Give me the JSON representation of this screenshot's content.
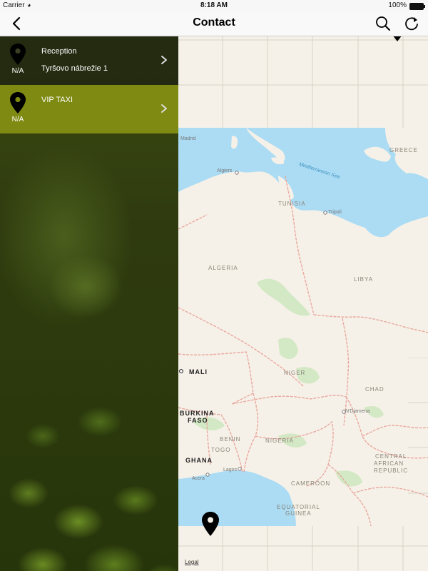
{
  "status_bar": {
    "carrier": "Carrier",
    "time": "8:18 AM",
    "battery": "100%"
  },
  "nav": {
    "title": "Contact",
    "back_icon": "chevron-left-icon",
    "search_icon": "search-icon",
    "refresh_icon": "refresh-icon"
  },
  "contacts": [
    {
      "pin_label": "N/A",
      "name": "Reception",
      "address": "Tyršovo nábrežie 1"
    },
    {
      "pin_label": "N/A",
      "name": "VIP TAXI",
      "address": ""
    }
  ],
  "map": {
    "labels": {
      "madrid": "Madrid",
      "algiers": "Algiers",
      "tunisia": "TUNISIA",
      "tripoli": "Tripoli",
      "greece": "GREECE",
      "mediterranean": "Mediterranean Sea",
      "algeria": "ALGERIA",
      "libya": "LIBYA",
      "mali": "MALI",
      "niger": "NIGER",
      "chad": "CHAD",
      "ndjamena": "N'Djamena",
      "burkina": "BURKINA",
      "faso": "FASO",
      "benin": "BENIN",
      "togo": "TOGO",
      "nigeria": "NIGERIA",
      "ghana": "GHANA",
      "accra": "Accra",
      "lagos": "Lagos",
      "cameroon": "CAMEROON",
      "central": "CENTRAL",
      "african": "AFRICAN",
      "republic": "REPUBLIC",
      "equatorial": "EQUATORIAL",
      "guinea": "GUINEA"
    },
    "legal": "Legal",
    "colors": {
      "land": "#f6f1e8",
      "water": "#abdcf4",
      "border": "#e8a8a0",
      "vegetation": "#d3e8c4"
    }
  },
  "colors": {
    "selected_row": "#7f8a12",
    "row": "#1e2212"
  }
}
